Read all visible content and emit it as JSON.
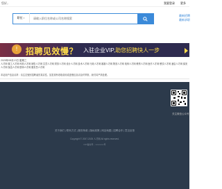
{
  "topbar": {
    "left_text": "您好，",
    "login": "我要登录",
    "more": "更多"
  },
  "search": {
    "type_label": "职位",
    "placeholder": "请输入职位名称或公司名称搜索",
    "button_label": "搜索"
  },
  "side_links": [
    "最新招聘",
    "最新求职"
  ],
  "banner": {
    "headline": "招聘见效慢？",
    "sub_prefix": "入驻企业VIP,",
    "sub_highlight": "助您招聘快人一步"
  },
  "meta": "2025年08月13日 星期三",
  "job_categories_text": "人才网 普工人才网 司机人才网 销售人才网 文员人才网 财务人才网 设计人才网 技术人才网 行政人才网 客服人才网 物流人才网 电商人才网 教育人才网 医疗人才网 餐饮人才网 酒店人才网 保安人才网 保洁人才网 厨师人才网 服务员人才网",
  "notice": "本站用户信息请求：请注意甄别招聘者的真实性，如发现有收取费用或虚假信息请及时举报，我们将严肃处理。",
  "footer": {
    "qr_label": "关注微信公众号",
    "links": "关于我们 | 联系方式 | 服务条款 | 隐私政策 | 网站地图 | 招聘合作 | 意见反馈",
    "copyright": "Copyright © 2007-2025 人才网 All rights reserved.",
    "icp": "ICP备案号：xxxxxxxx号"
  },
  "colors": {
    "accent": "#3b8ad9",
    "banner_bg": "#2e2b4f",
    "banner_text": "#ffdc4a",
    "footer_bg": "#2c3a4b"
  }
}
